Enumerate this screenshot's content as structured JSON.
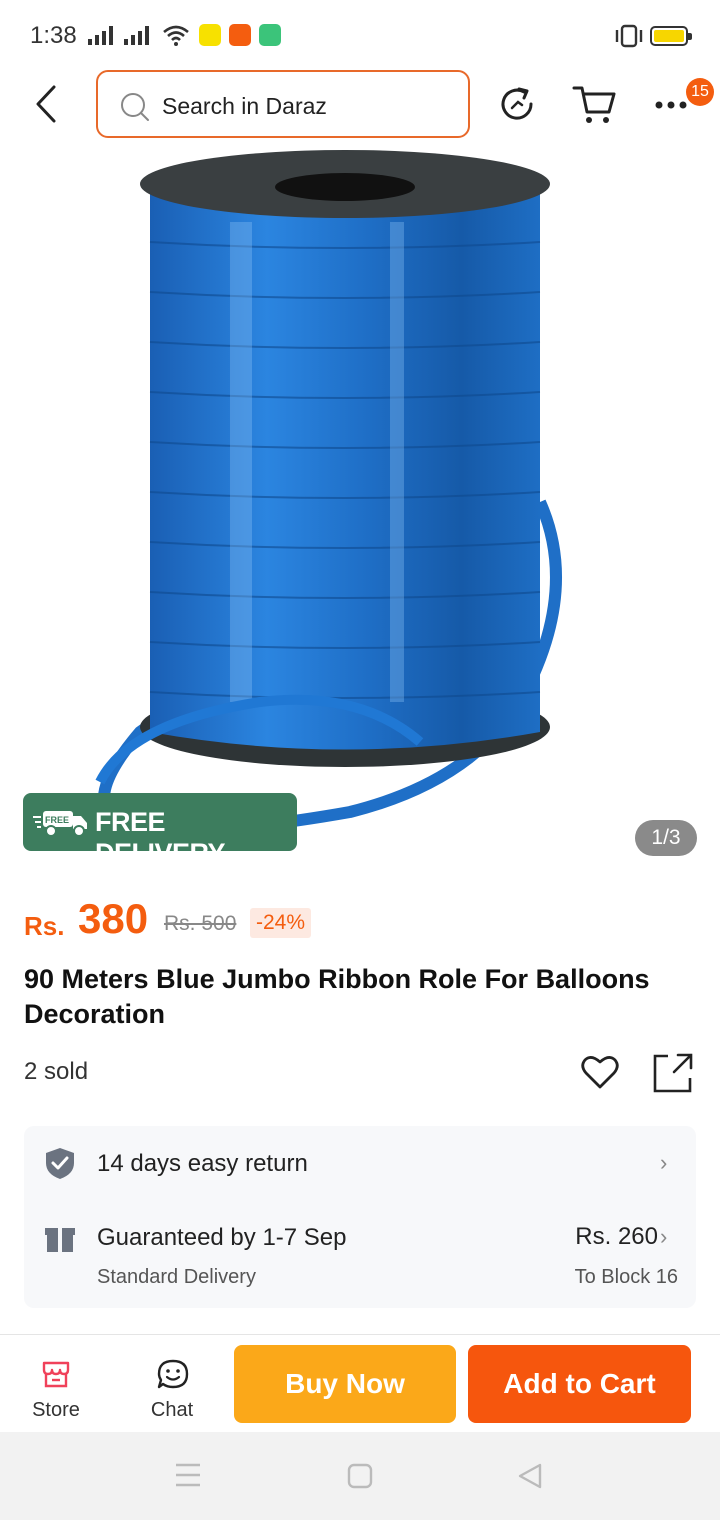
{
  "status_bar": {
    "time": "1:38"
  },
  "header": {
    "search_placeholder": "Search in Daraz",
    "menu_badge": "15",
    "icons": [
      "back-arrow-icon",
      "search-icon",
      "refresh-icon",
      "cart-icon",
      "more-icon"
    ]
  },
  "gallery": {
    "free_delivery": "FREE DELIVERY",
    "free_tag": "FREE",
    "counter": "1/3"
  },
  "product": {
    "currency": "Rs.",
    "price": "380",
    "old_price": "Rs. 500",
    "discount": "-24%",
    "title": "90 Meters Blue Jumbo Ribbon Role For Balloons Decoration",
    "sold": "2 sold"
  },
  "services": {
    "return_text": "14 days easy return",
    "delivery_text": "Guaranteed by 1-7 Sep",
    "delivery_type": "Standard Delivery",
    "delivery_fee": "Rs. 260",
    "destination": "To Block 16"
  },
  "bottom_bar": {
    "store": "Store",
    "chat": "Chat",
    "buy_now": "Buy Now",
    "add_to_cart": "Add to Cart"
  },
  "colors": {
    "accent": "#f45d0f",
    "buy_now": "#fba819",
    "add_to_cart": "#f6560d",
    "free_delivery": "#3d7d5e",
    "ribbon": "#1f6fc7"
  }
}
